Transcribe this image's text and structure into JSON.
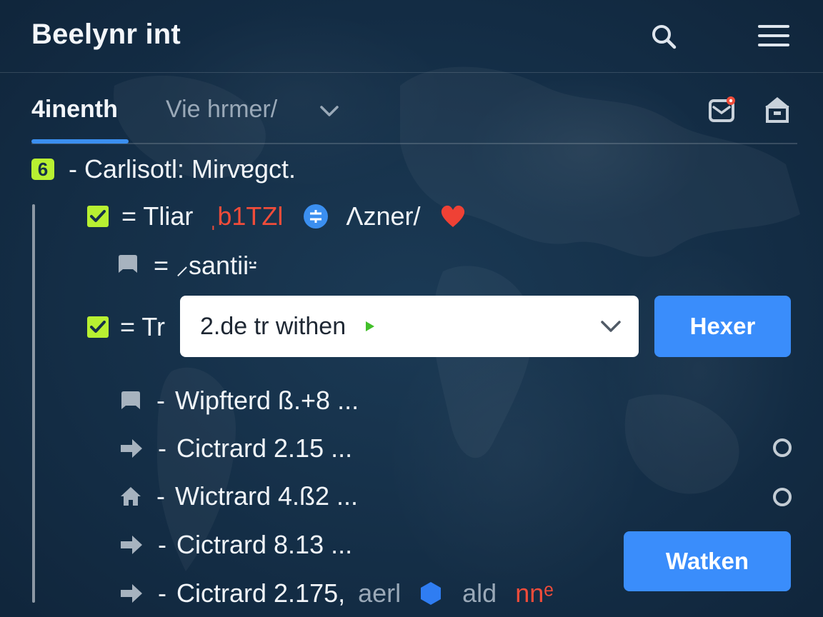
{
  "header": {
    "title": "Beelynr int"
  },
  "tabs": [
    {
      "label": "4inenth"
    },
    {
      "label": "Vie hrmer/"
    }
  ],
  "section": {
    "badge": "6",
    "title": "- Carlisotl: Mirvɐgct."
  },
  "rows": {
    "tliar": {
      "prefix": "= Tliar",
      "tag": "ˌb1TZl",
      "name": "Λzner/"
    },
    "asantii": {
      "label": "= ⸝santii⸚"
    },
    "tr": {
      "prefix": "= Tr",
      "select_value": "2.de tr withen",
      "button": "Hexer"
    },
    "list": [
      {
        "label": "Wipfterd ß.+8 ..."
      },
      {
        "label": "Cictrard 2.15 ..."
      },
      {
        "label": "Wictrard 4.ß2 ..."
      },
      {
        "label": "Cictrard 8.13 ..."
      },
      {
        "label": "Cictrard 2.175,",
        "extra1": "aerl",
        "extra2": "ald",
        "extra3": "nnᵉ"
      }
    ],
    "list_sep": "-",
    "watken": "Watken"
  },
  "colors": {
    "accent": "#3b8ff0",
    "check": "#b8f032",
    "danger": "#f04c3a",
    "background": "#16304a"
  },
  "icons": [
    "search-icon",
    "menu-icon",
    "chevron-down-icon",
    "mail-notification-icon",
    "home-icon",
    "check-icon",
    "transfer-icon",
    "heart-icon",
    "chat-icon",
    "arrow-right-icon",
    "home-small-icon",
    "play-icon",
    "hexagon-icon"
  ]
}
